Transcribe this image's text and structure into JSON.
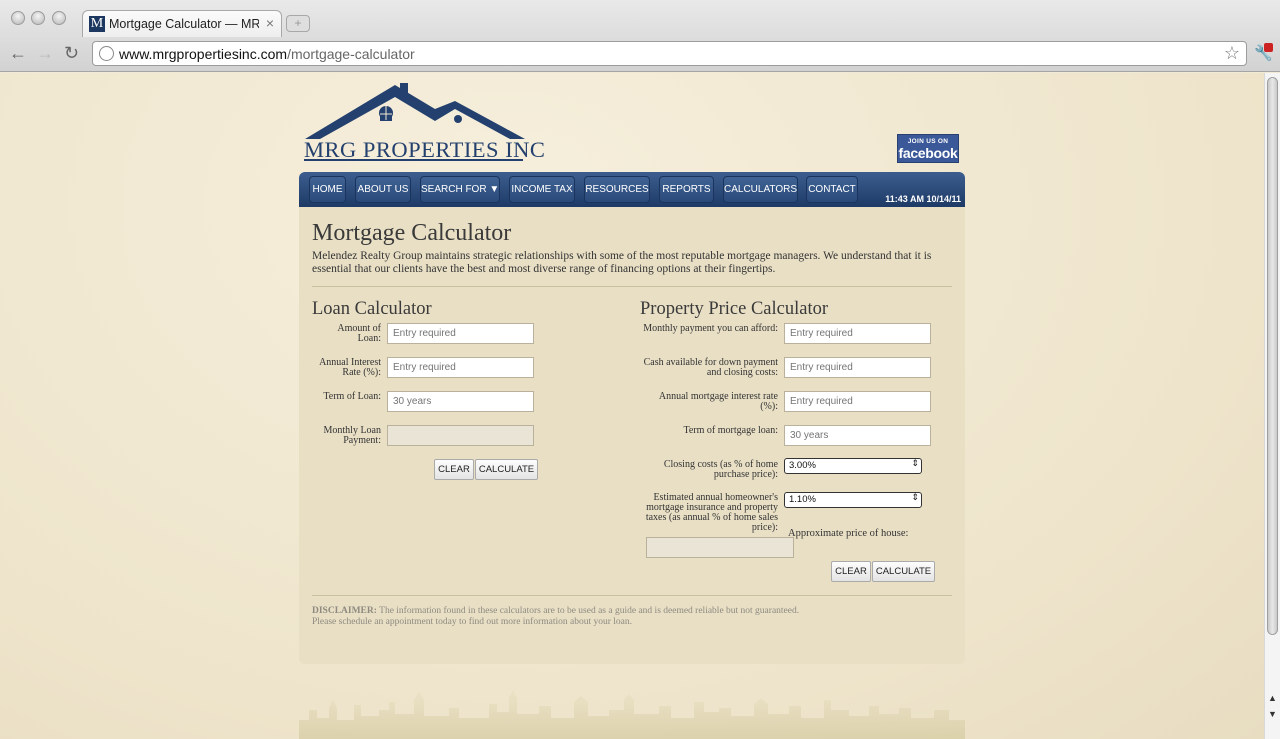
{
  "browser": {
    "tab_title": "Mortgage Calculator — MRG",
    "tab_favicon": "M",
    "url_host": "www.mrgpropertiesinc.com",
    "url_path": "/mortgage-calculator"
  },
  "header": {
    "logo_text": "MRG PROPERTIES INC",
    "facebook_small": "JOIN US ON",
    "facebook_big": "facebook"
  },
  "nav": {
    "items": [
      "HOME",
      "ABOUT US",
      "SEARCH FOR ▼",
      "INCOME TAX",
      "RESOURCES",
      "REPORTS",
      "CALCULATORS",
      "CONTACT"
    ],
    "datetime": "11:43 AM 10/14/11"
  },
  "main": {
    "title": "Mortgage Calculator",
    "intro": "Melendez Realty Group maintains strategic relationships with some of the most reputable mortgage managers. We understand that it is essential that our clients have the best and most diverse range of financing options at their fingertips."
  },
  "loan_calc": {
    "title": "Loan Calculator",
    "fields": [
      {
        "label": "Amount of Loan:",
        "placeholder": "Entry required"
      },
      {
        "label": "Annual Interest Rate (%):",
        "placeholder": "Entry required"
      },
      {
        "label": "Term of Loan:",
        "placeholder": "30 years"
      },
      {
        "label": "Monthly Loan Payment:",
        "placeholder": ""
      }
    ],
    "clear": "CLEAR",
    "calculate": "CALCULATE"
  },
  "price_calc": {
    "title": "Property Price Calculator",
    "fields": [
      {
        "label": "Monthly payment you can afford:",
        "placeholder": "Entry required"
      },
      {
        "label": "Cash available for down payment and closing costs:",
        "placeholder": "Entry required"
      },
      {
        "label": "Annual mortgage interest rate (%):",
        "placeholder": "Entry required"
      },
      {
        "label": "Term of mortgage loan:",
        "placeholder": "30 years"
      }
    ],
    "closing_label": "Closing costs (as % of home purchase price):",
    "closing_value": "3.00%",
    "insurance_label": "Estimated annual homeowner's mortgage insurance and property taxes (as annual % of home sales price):",
    "insurance_value": "1.10%",
    "approx_label": "Approximate price of house:",
    "clear": "CLEAR",
    "calculate": "CALCULATE"
  },
  "disclaimer": {
    "label": "DISCLAIMER:",
    "text1": " The information found in these calculators are to be used as a guide and is deemed reliable but not guaranteed.",
    "text2": "Please schedule an appointment today to find out more information about your loan."
  },
  "colors": {
    "brand_navy": "#23406e",
    "nav_bg": "#1e3a66",
    "page_bg": "#eee4cb",
    "content_bg": "#e8dfc5",
    "facebook": "#3b5998"
  }
}
